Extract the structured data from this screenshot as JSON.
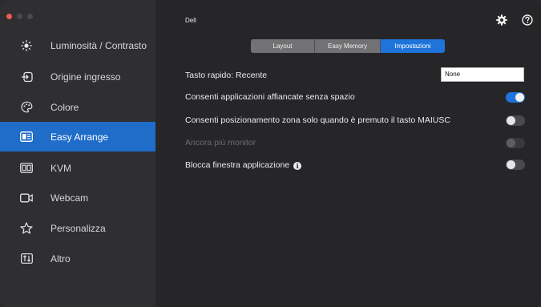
{
  "app": {
    "title": "Dell"
  },
  "sidebar": {
    "items": [
      {
        "label": "Luminosità / Contrasto",
        "icon": "brightness-icon",
        "active": false
      },
      {
        "label": "Origine ingresso",
        "icon": "input-source-icon",
        "active": false
      },
      {
        "label": "Colore",
        "icon": "color-palette-icon",
        "active": false
      },
      {
        "label": "Easy Arrange",
        "icon": "easy-arrange-icon",
        "active": true
      },
      {
        "label": "KVM",
        "icon": "kvm-icon",
        "active": false
      },
      {
        "label": "Webcam",
        "icon": "webcam-icon",
        "active": false
      },
      {
        "label": "Personalizza",
        "icon": "star-icon",
        "active": false
      },
      {
        "label": "Altro",
        "icon": "other-icon",
        "active": false
      }
    ]
  },
  "tabs": [
    {
      "label": "Layout",
      "active": false
    },
    {
      "label": "Easy Memory",
      "active": false
    },
    {
      "label": "Impostazioni",
      "active": true
    }
  ],
  "settings": {
    "hotkey": {
      "label": "Tasto rapido: Recente",
      "value": "None"
    },
    "rows": [
      {
        "label": "Consenti applicazioni affiancate senza spazio",
        "state": "on",
        "enabled": true
      },
      {
        "label": "Consenti posizionamento zona solo quando è premuto il tasto MAIUSC",
        "state": "off",
        "enabled": true
      },
      {
        "label": "Ancora più monitor",
        "state": "off",
        "enabled": false
      },
      {
        "label": "Blocca finestra applicazione",
        "state": "off",
        "enabled": true,
        "info": "i"
      }
    ]
  },
  "colors": {
    "accent": "#1f74db",
    "sidebar_active": "#1f6cc9",
    "close_button": "#ee5a52"
  }
}
